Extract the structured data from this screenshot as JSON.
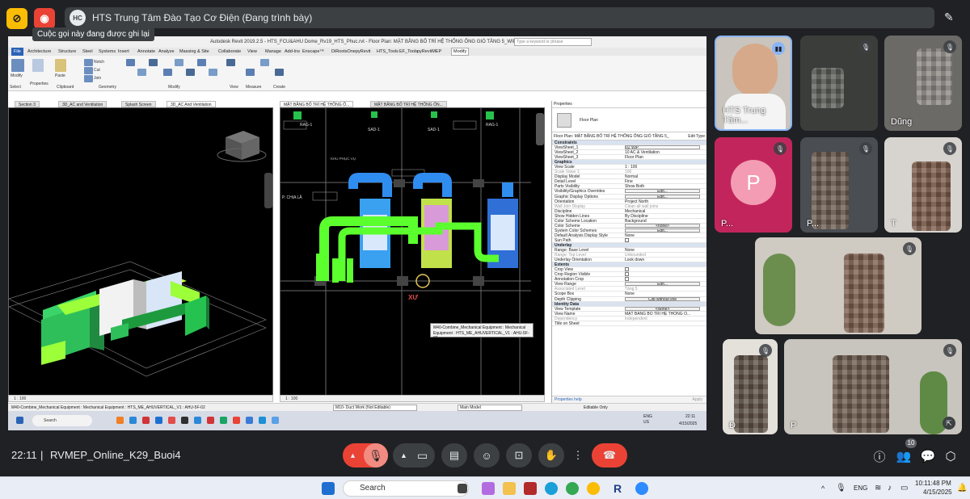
{
  "meet": {
    "presentation_title": "HTS Trung Tâm Đào Tạo Cơ Điện (Đang trình bày)",
    "logo_text": "HC",
    "recording_tooltip": "Cuộc gọi này đang được ghi lại",
    "time": "22:11",
    "meeting_name": "RVMEP_Online_K29_Buoi4",
    "participant_count": "10",
    "colors": {
      "bg": "#202124",
      "end_call": "#ea4335",
      "mic_off": "#ea4335",
      "avatar_pink": "#f39cb3"
    }
  },
  "participants": [
    {
      "name": "HTS Trung Tâm...",
      "mic": "speaking"
    },
    {
      "name": "",
      "mic": "muted"
    },
    {
      "name": "Dũng",
      "mic": "muted"
    },
    {
      "name": "P...",
      "avatar_letter": "P",
      "mic": "muted"
    },
    {
      "name": "P...",
      "mic": "muted"
    },
    {
      "name": "T",
      "mic": "muted"
    },
    {
      "name": "",
      "mic": "muted"
    },
    {
      "name": "Đ",
      "mic": "muted"
    },
    {
      "name": "P",
      "mic": "muted"
    }
  ],
  "revit": {
    "title": "Autodesk Revit 2019.2.5 - HTS_FCU&AHU Dome_Rv19_HTS_Phuc.rvt - Floor Plan: MẶT BẰNG BỐ TRÍ HỆ THỐNG ỐNG GIÓ TẦNG 5_WIP",
    "search_placeholder": "Type a keyword or phrase",
    "tabs": [
      "File",
      "Architecture",
      "Structure",
      "Steel",
      "Systems",
      "Insert",
      "Annotate",
      "Analyze",
      "Massing & Site",
      "Collaborate",
      "View",
      "Manage",
      "Add-Ins",
      "Enscape™",
      "DiRootsOne",
      "pyRevit",
      "HTS_Tools",
      "EF_Tools",
      "pyRevitMEP",
      "Modify"
    ],
    "ribbon_groups": [
      "Select",
      "Properties",
      "Clipboard",
      "Geometry",
      "Modify",
      "View",
      "Measure",
      "Create"
    ],
    "ribbon_tools": [
      "Modify",
      "Properties",
      "Paste",
      "Notch",
      "Cut",
      "Join"
    ],
    "view_tabs": [
      "Section 3",
      "3D_AC and Ventilation",
      "Splash Screen",
      "3D_AC And Ventilation",
      "MẶT BẰNG BỐ TRÍ HỆ THỐNG Ố...",
      "MẶT BẰNG BỐ TRÍ HỆ THỐNG ỐN..."
    ],
    "scale_left": "1 : 100",
    "scale_right": "1 : 100",
    "plan_tags": [
      "RAG-1",
      "SAD-1",
      "SAD-1",
      "RAG-1",
      "KHU PHỤC VỤ",
      "P. CHIA LĂ",
      "XƯ"
    ],
    "tooltip": "M40-Combine_Mechanical Equipment : Mechanical Equipment : HTS_ME_AHUVERTICAL_V1 : AHU-5F-02",
    "status_text": "M40-Combine_Mechanical Equipment : Mechanical Equipment : HTS_ME_AHUVERTICAL_V1 : AHU-5F-02",
    "status_workset": "M10- Duct Work (Not Editable)",
    "status_model": "Main Model",
    "status_editable": "Editable Only",
    "properties": {
      "header": "Properties",
      "type_name": "Floor Plan",
      "selector": "Floor Plan: MẶT BẰNG BỐ TRÍ HỆ THỐNG ỐNG GIÓ TẦNG 5_",
      "edit_type": "Edit Type",
      "rows": [
        {
          "k": "Constraints",
          "section": true
        },
        {
          "k": "ViewSheet_1",
          "v": "02 WIP",
          "box": true
        },
        {
          "k": "ViewSheet_2",
          "v": "10 AC & Ventilation"
        },
        {
          "k": "ViewSheet_3",
          "v": "Floor Plan"
        },
        {
          "k": "Graphics",
          "section": true
        },
        {
          "k": "View Scale",
          "v": "1 : 100"
        },
        {
          "k": "Scale Value    1:",
          "v": "100",
          "dim": true
        },
        {
          "k": "Display Model",
          "v": "Normal"
        },
        {
          "k": "Detail Level",
          "v": "Fine"
        },
        {
          "k": "Parts Visibility",
          "v": "Show Both"
        },
        {
          "k": "Visibility/Graphics Overrides",
          "v": "Edit...",
          "btn": true
        },
        {
          "k": "Graphic Display Options",
          "v": "Edit...",
          "btn": true
        },
        {
          "k": "Orientation",
          "v": "Project North"
        },
        {
          "k": "Wall Join Display",
          "v": "Clean all wall joins",
          "dim": true
        },
        {
          "k": "Discipline",
          "v": "Mechanical"
        },
        {
          "k": "Show Hidden Lines",
          "v": "By Discipline"
        },
        {
          "k": "Color Scheme Location",
          "v": "Background"
        },
        {
          "k": "Color Scheme",
          "v": "<none>",
          "btn": true
        },
        {
          "k": "System Color Schemes",
          "v": "Edit...",
          "btn": true
        },
        {
          "k": "Default Analysis Display Style",
          "v": "None"
        },
        {
          "k": "Sun Path",
          "v": "",
          "check": true
        },
        {
          "k": "Underlay",
          "section": true
        },
        {
          "k": "Range: Base Level",
          "v": "None"
        },
        {
          "k": "Range: Top Level",
          "v": "Unbounded",
          "dim": true
        },
        {
          "k": "Underlay Orientation",
          "v": "Look down"
        },
        {
          "k": "Extents",
          "section": true
        },
        {
          "k": "Crop View",
          "v": "",
          "check": true
        },
        {
          "k": "Crop Region Visible",
          "v": "",
          "check": true
        },
        {
          "k": "Annotation Crop",
          "v": "",
          "check": true
        },
        {
          "k": "View Range",
          "v": "Edit...",
          "btn": true
        },
        {
          "k": "Associated Level",
          "v": "Tầng 5",
          "dim": true
        },
        {
          "k": "Scope Box",
          "v": "None"
        },
        {
          "k": "Depth Clipping",
          "v": "Clip without line",
          "btn": true
        },
        {
          "k": "Identity Data",
          "section": true
        },
        {
          "k": "View Template",
          "v": "<None>",
          "btn": true
        },
        {
          "k": "View Name",
          "v": "MẶT BẰNG BỐ TRÍ HỆ THỐNG Ố..."
        },
        {
          "k": "Dependency",
          "v": "Independent",
          "dim": true
        },
        {
          "k": "Title on Sheet",
          "v": ""
        }
      ],
      "help_link": "Properties help",
      "apply": "Apply"
    },
    "inner_taskbar": {
      "search": "Search",
      "lang": "ENG\nUS",
      "time": "22:11",
      "date": "4/15/2025"
    }
  },
  "os_taskbar": {
    "search": "Search",
    "lang": "ENG",
    "time": "10:11:48 PM",
    "date": "4/15/2025"
  }
}
